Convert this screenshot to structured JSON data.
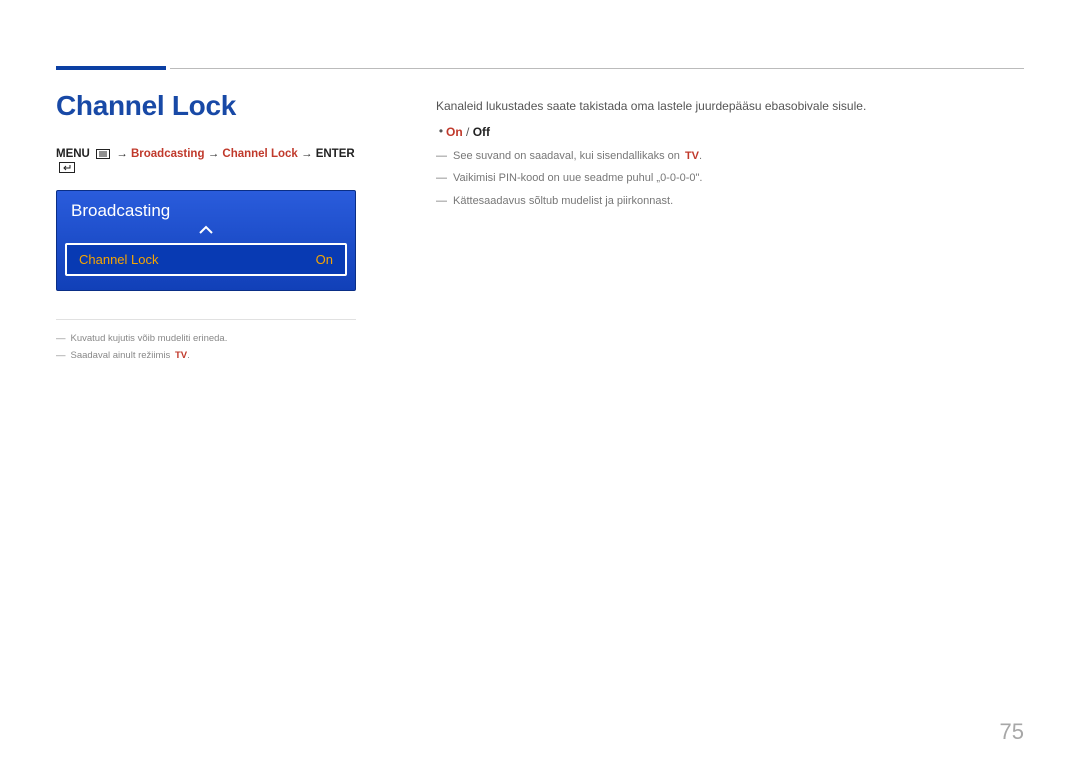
{
  "title": "Channel Lock",
  "breadcrumb": {
    "menu": "MENU",
    "arrow": "→",
    "broadcasting": "Broadcasting",
    "channel_lock": "Channel Lock",
    "enter": "ENTER"
  },
  "panel": {
    "title": "Broadcasting",
    "item_label": "Channel Lock",
    "item_value": "On"
  },
  "left_notes": {
    "n1": "Kuvatud kujutis võib mudeliti erineda.",
    "n2_prefix": "Saadaval ainult režiimis",
    "tv": "TV",
    "period": "."
  },
  "right": {
    "intro": "Kanaleid lukustades saate takistada oma lastele juurdepääsu ebasobivale sisule.",
    "on": "On",
    "slash": " / ",
    "off": "Off",
    "sub1_prefix": "See suvand on saadaval, kui sisendallikaks on",
    "sub1_tv": "TV",
    "sub1_period": ".",
    "sub2": "Vaikimisi PIN-kood on uue seadme puhul „0-0-0-0\".",
    "sub3": "Kättesaadavus sõltub mudelist ja piirkonnast."
  },
  "page_number": "75"
}
